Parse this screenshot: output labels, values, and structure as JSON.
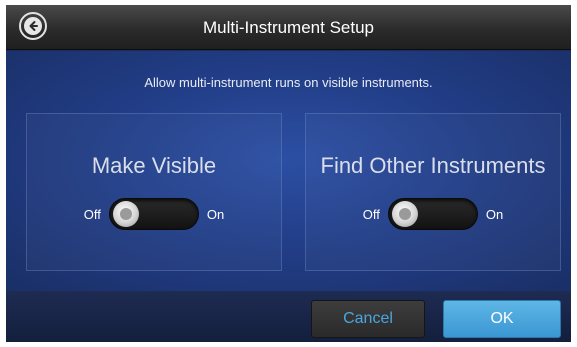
{
  "header": {
    "title": "Multi-Instrument Setup",
    "back_icon": "back-arrow-icon"
  },
  "main": {
    "subtitle": "Allow multi-instrument runs on visible instruments.",
    "panels": [
      {
        "title": "Make Visible",
        "off_label": "Off",
        "on_label": "On",
        "state": "off"
      },
      {
        "title": "Find Other Instruments",
        "off_label": "Off",
        "on_label": "On",
        "state": "off"
      }
    ]
  },
  "footer": {
    "cancel_label": "Cancel",
    "ok_label": "OK"
  },
  "colors": {
    "titlebar": "#2b2b2b",
    "background": "#223e88",
    "accent": "#3a97d3",
    "cancel_text": "#4aa6e0"
  }
}
